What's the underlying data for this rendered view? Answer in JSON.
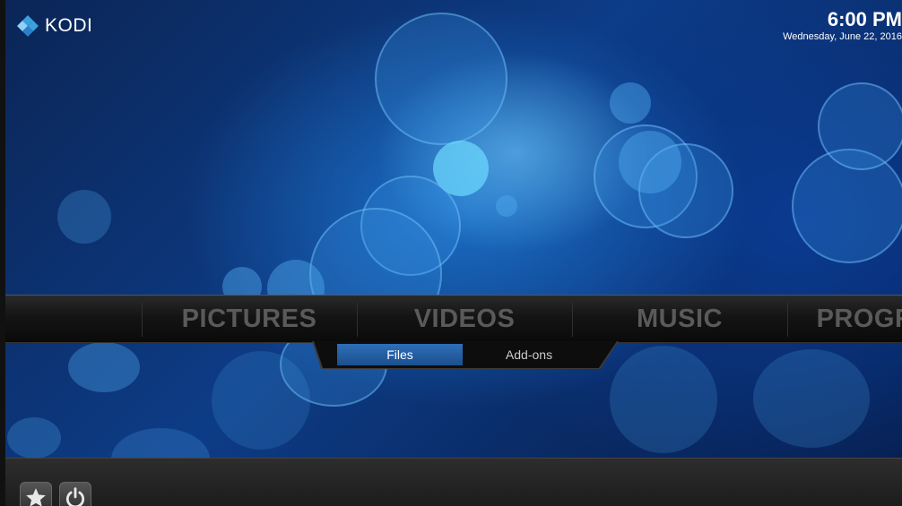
{
  "header": {
    "logo_text": "KODI",
    "time": "6:00 PM",
    "date": "Wednesday, June 22, 2016"
  },
  "main_menu": {
    "items": [
      {
        "label": "PICTURES"
      },
      {
        "label": "VIDEOS"
      },
      {
        "label": "MUSIC"
      },
      {
        "label": "PROGRAMS"
      }
    ]
  },
  "submenu": {
    "items": [
      {
        "label": "Files",
        "active": true
      },
      {
        "label": "Add-ons",
        "active": false
      }
    ]
  },
  "bottom_bar": {
    "buttons": [
      {
        "icon": "star-icon"
      },
      {
        "icon": "power-icon"
      }
    ]
  },
  "colors": {
    "accent": "#2f6fb8",
    "menu_text": "#5a5a5a",
    "background": "#0d3c86"
  }
}
